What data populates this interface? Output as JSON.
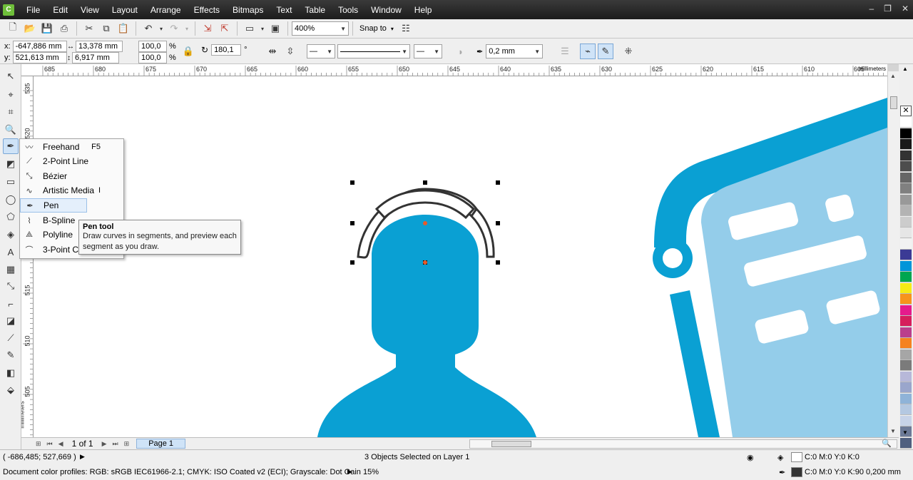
{
  "menubar": {
    "items": [
      "File",
      "Edit",
      "View",
      "Layout",
      "Arrange",
      "Effects",
      "Bitmaps",
      "Text",
      "Table",
      "Tools",
      "Window",
      "Help"
    ]
  },
  "standard_toolbar": {
    "zoom_level": "400%",
    "snap_to": "Snap to"
  },
  "property_bar": {
    "x_label": "x:",
    "x_value": "-647,886 mm",
    "y_label": "y:",
    "y_value": "521,613 mm",
    "width_value": "13,378 mm",
    "height_value": "6,917 mm",
    "scale_w": "100,0",
    "scale_h": "100,0",
    "percent": "%",
    "rotation": "180,1",
    "degree": "°",
    "outline_width": "0,2 mm"
  },
  "ruler": {
    "top_ticks": [
      "685",
      "680",
      "675",
      "670",
      "665",
      "660",
      "655",
      "650",
      "645",
      "640",
      "635",
      "630",
      "625",
      "620",
      "615",
      "610",
      "605"
    ],
    "top_unit": "millimeters",
    "left_ticks": [
      "535",
      "520",
      "515",
      "510",
      "505"
    ],
    "left_unit": "millimeters"
  },
  "flyout": {
    "items": [
      {
        "label": "Freehand",
        "shortcut": "F5",
        "icon": "freehand-icon"
      },
      {
        "label": "2-Point Line",
        "shortcut": "",
        "icon": "two-point-line-icon"
      },
      {
        "label": "Bézier",
        "shortcut": "",
        "icon": "bezier-icon"
      },
      {
        "label": "Artistic Media",
        "shortcut": "I",
        "icon": "artistic-media-icon"
      },
      {
        "label": "Pen",
        "shortcut": "",
        "icon": "pen-icon"
      },
      {
        "label": "B-Spline",
        "shortcut": "",
        "icon": "b-spline-icon"
      },
      {
        "label": "Polyline",
        "shortcut": "",
        "icon": "polyline-icon"
      },
      {
        "label": "3-Point Cu",
        "shortcut": "",
        "icon": "three-point-curve-icon"
      }
    ]
  },
  "tooltip": {
    "title": "Pen tool",
    "description": "Draw curves in segments, and preview each segment as you draw."
  },
  "pagebar": {
    "page_count": "1 of 1",
    "page_tab": "Page 1"
  },
  "status": {
    "cursor_pos": "( -686,485; 527,669 )",
    "selection": "3 Objects Selected on Layer 1",
    "color_profiles": "Document color profiles: RGB: sRGB IEC61966-2.1; CMYK: ISO Coated v2 (ECI); Grayscale: Dot Gain 15%",
    "fill_info": "C:0 M:0 Y:0 K:0",
    "outline_info": "C:0 M:0 Y:0 K:90  0,200 mm"
  },
  "colors": {
    "brand_blue": "#0aa0d3",
    "light_blue": "#94cdea",
    "outline_dark": "#333333",
    "center_marker": "#e55b2c"
  },
  "palette": [
    "#ffffff",
    "#000000",
    "#1a1a1a",
    "#333333",
    "#4d4d4d",
    "#666666",
    "#808080",
    "#999999",
    "#b3b3b3",
    "#cccccc",
    "#e6e6e6",
    "#f2f2f2",
    "#3b3a95",
    "#0095d9",
    "#00a650",
    "#f6eb16",
    "#f7941d",
    "#e51b8c",
    "#d61e5c",
    "#ba3f8c",
    "#f58220",
    "#a6a6a6",
    "#7b7b7b",
    "#b7b8d9",
    "#9aa6cc",
    "#8fb3d8",
    "#b4c8e1",
    "#c7d3e8",
    "#6c7a97",
    "#4f5f7f"
  ]
}
